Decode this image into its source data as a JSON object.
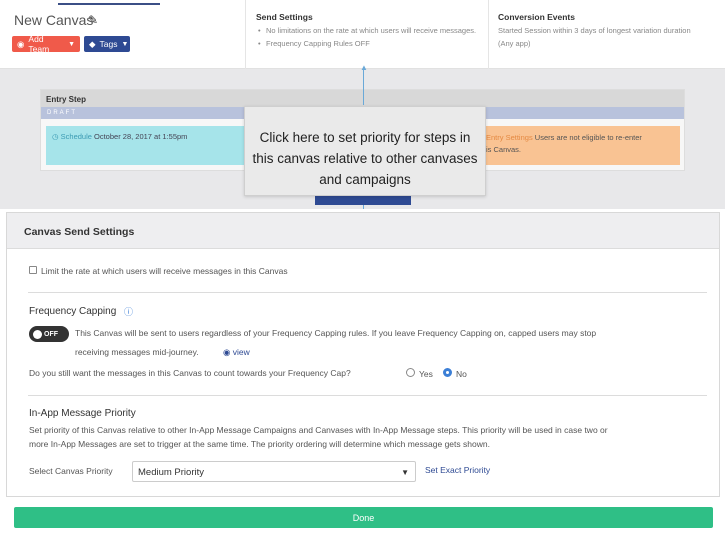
{
  "header": {
    "canvas_name": "New Canvas",
    "add_team_label": "Add Team",
    "tags_label": "Tags",
    "send_settings": {
      "title": "Send Settings",
      "bullets": [
        "No limitations on the rate at which users will receive messages.",
        "Frequency Capping Rules OFF"
      ]
    },
    "conversion_events": {
      "title": "Conversion Events",
      "line1": "Started Session within 3 days of longest variation duration",
      "line2": "(Any app)"
    }
  },
  "entry_step": {
    "title": "Entry Step",
    "status": "DRAFT",
    "schedule_label": "Schedule",
    "schedule_value": "October 28, 2017 at 1:55pm",
    "reentry_label": "Entry Settings",
    "reentry_text": "Users are not eligible to re-enter",
    "reentry_text2": "is Canvas."
  },
  "tooltip": {
    "text": "Click here to set priority for steps in this canvas relative to other canvases and campaigns"
  },
  "modal": {
    "title": "Canvas Send Settings",
    "rate_limit_label": "Limit the rate at which users will receive messages in this Canvas",
    "frequency_capping": {
      "title": "Frequency Capping",
      "toggle_label": "OFF",
      "description": "This Canvas will be sent to users regardless of your Frequency Capping rules. If you leave Frequency Capping on, capped users may stop",
      "description2": "receiving messages mid-journey.",
      "view_label": "view",
      "question": "Do you still want the messages in this Canvas to count towards your Frequency Cap?",
      "yes_label": "Yes",
      "no_label": "No",
      "selected": "No"
    },
    "priority": {
      "title": "In-App Message Priority",
      "line1": "Set priority of this Canvas relative to other In-App Message Campaigns and Canvases with In-App Message steps. This priority will be used in case two or",
      "line2": "more In-App Messages are set to trigger at the same time. The priority ordering will determine which message gets shown.",
      "select_label": "Select Canvas Priority",
      "select_value": "Medium Priority",
      "exact_link": "Set Exact Priority"
    }
  },
  "footer": {
    "done_label": "Done"
  },
  "colors": {
    "accent": "#2e4a93",
    "done": "#2fbf86",
    "add_team": "#f05a4a",
    "radio_selected": "#3c7fd6"
  }
}
